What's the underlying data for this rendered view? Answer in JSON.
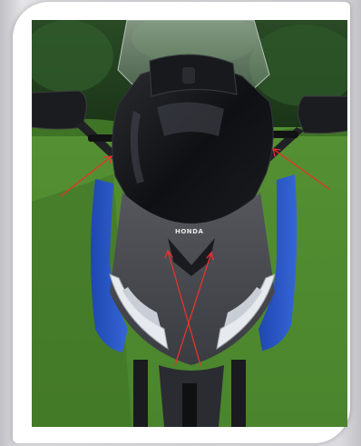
{
  "photo": {
    "subject_brand_text": "HONDA",
    "colors": {
      "grass": "#4e8a2e",
      "hedge": "#1f3d1c",
      "body_blue": "#2c57c8",
      "fairing_black": "#141518",
      "annotation_arrow": "#e8322b"
    }
  }
}
